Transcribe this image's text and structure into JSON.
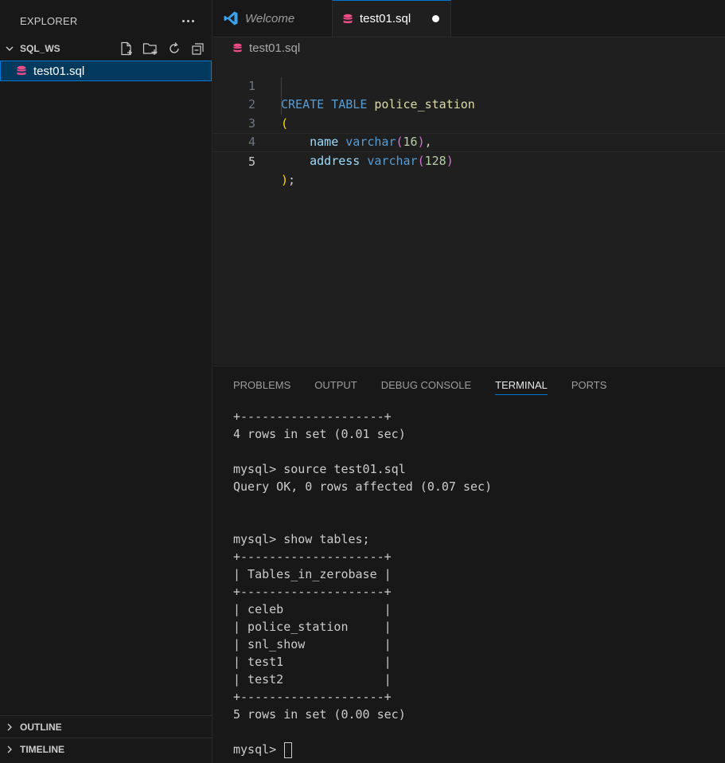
{
  "sidebar": {
    "title": "EXPLORER",
    "workspace": "SQL_WS",
    "file": "test01.sql",
    "sections": [
      "OUTLINE",
      "TIMELINE"
    ]
  },
  "editor": {
    "tabs": [
      {
        "label": "Welcome",
        "icon": "vscode-icon"
      },
      {
        "label": "test01.sql",
        "icon": "database-icon",
        "modified": true
      }
    ],
    "breadcrumb": "test01.sql",
    "line_numbers": [
      "1",
      "2",
      "3",
      "4",
      "5"
    ],
    "code": {
      "l1": {
        "kw1": "CREATE",
        "kw2": "TABLE",
        "name": "police_station"
      },
      "l2": {
        "paren": "("
      },
      "l3": {
        "col": "name",
        "type": "varchar",
        "open": "(",
        "num": "16",
        "close": ")",
        "comma": ","
      },
      "l4": {
        "col": "address",
        "type": "varchar",
        "open": "(",
        "num": "128",
        "close": ")"
      },
      "l5": {
        "paren": ")",
        "semi": ";"
      }
    }
  },
  "panel": {
    "tabs": [
      "PROBLEMS",
      "OUTPUT",
      "DEBUG CONSOLE",
      "TERMINAL",
      "PORTS"
    ],
    "active_tab": "TERMINAL",
    "terminal_lines": [
      "+--------------------+",
      "4 rows in set (0.01 sec)",
      "",
      "mysql> source test01.sql",
      "Query OK, 0 rows affected (0.07 sec)",
      "",
      "",
      "mysql> show tables;",
      "+--------------------+",
      "| Tables_in_zerobase |",
      "+--------------------+",
      "| celeb              |",
      "| police_station     |",
      "| snl_show           |",
      "| test1              |",
      "| test2              |",
      "+--------------------+",
      "5 rows in set (0.00 sec)",
      ""
    ],
    "prompt": "mysql> "
  },
  "colors": {
    "accent": "#0078d4",
    "sql_icon": "#f14c8a",
    "vscode_icon": "#3aa3f0"
  }
}
